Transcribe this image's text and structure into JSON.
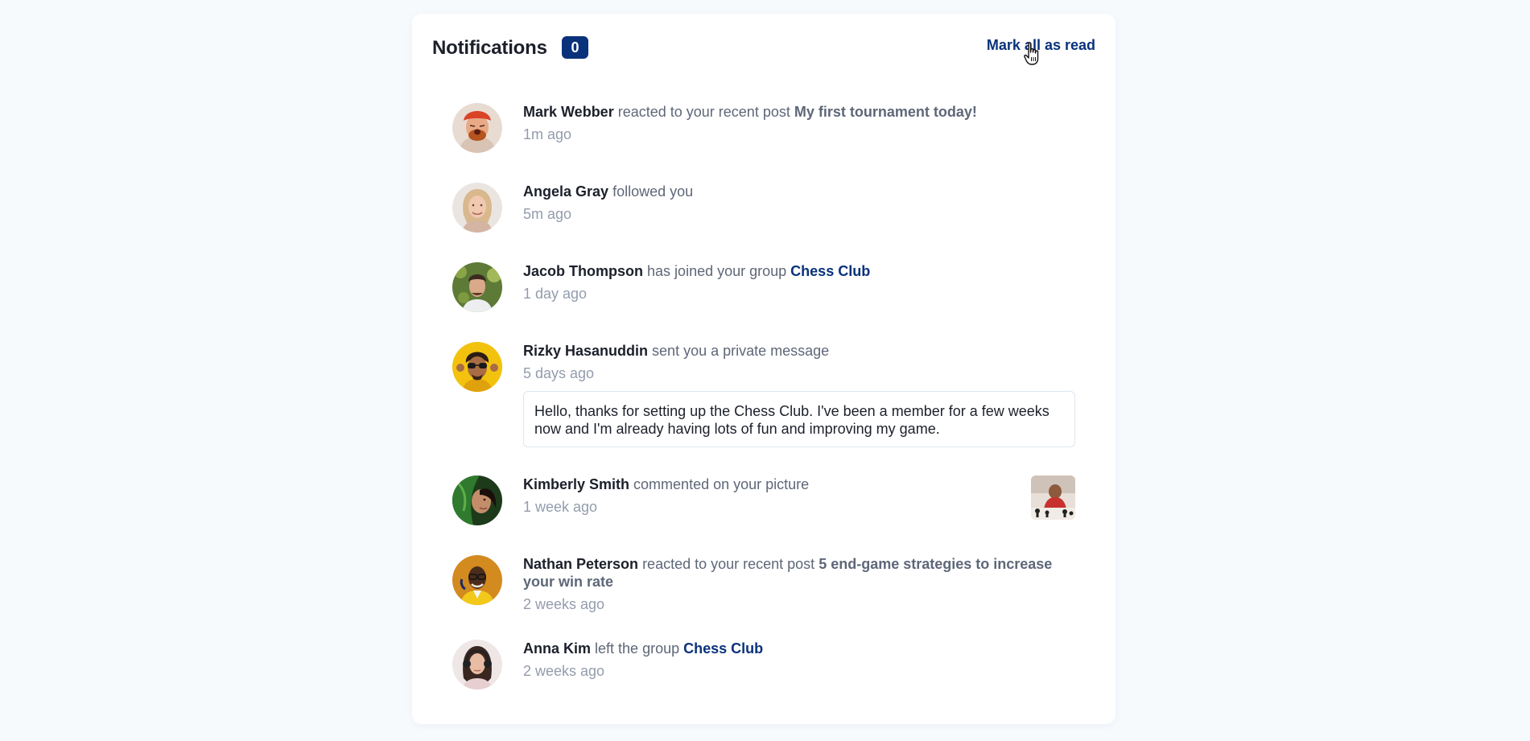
{
  "header": {
    "title": "Notifications",
    "unread_count": "0",
    "mark_all_label": "Mark all as read"
  },
  "colors": {
    "accent": "#0a327b",
    "background": "#f7fafd",
    "card": "#ffffff",
    "name": "#1c202b",
    "muted": "#939cad"
  },
  "notifications": [
    {
      "name": "Mark Webber",
      "action": "reacted to your recent post",
      "post": "My first tournament today!",
      "time": "1m ago"
    },
    {
      "name": "Angela Gray",
      "action": "followed you",
      "time": "5m ago"
    },
    {
      "name": "Jacob Thompson",
      "action": "has joined your group",
      "group": "Chess Club",
      "time": "1 day ago"
    },
    {
      "name": "Rizky Hasanuddin",
      "action": "sent you a private message",
      "time": "5 days ago",
      "message": "Hello, thanks for setting up the Chess Club. I've been a member for a few weeks now and I'm already having lots of fun and improving my game."
    },
    {
      "name": "Kimberly Smith",
      "action": "commented on your picture",
      "time": "1 week ago"
    },
    {
      "name": "Nathan Peterson",
      "action": "reacted to your recent post",
      "post": "5 end-game strategies to increase your win rate",
      "time": "2 weeks ago"
    },
    {
      "name": "Anna Kim",
      "action": "left the group",
      "group": "Chess Club",
      "time": "2 weeks ago"
    }
  ]
}
